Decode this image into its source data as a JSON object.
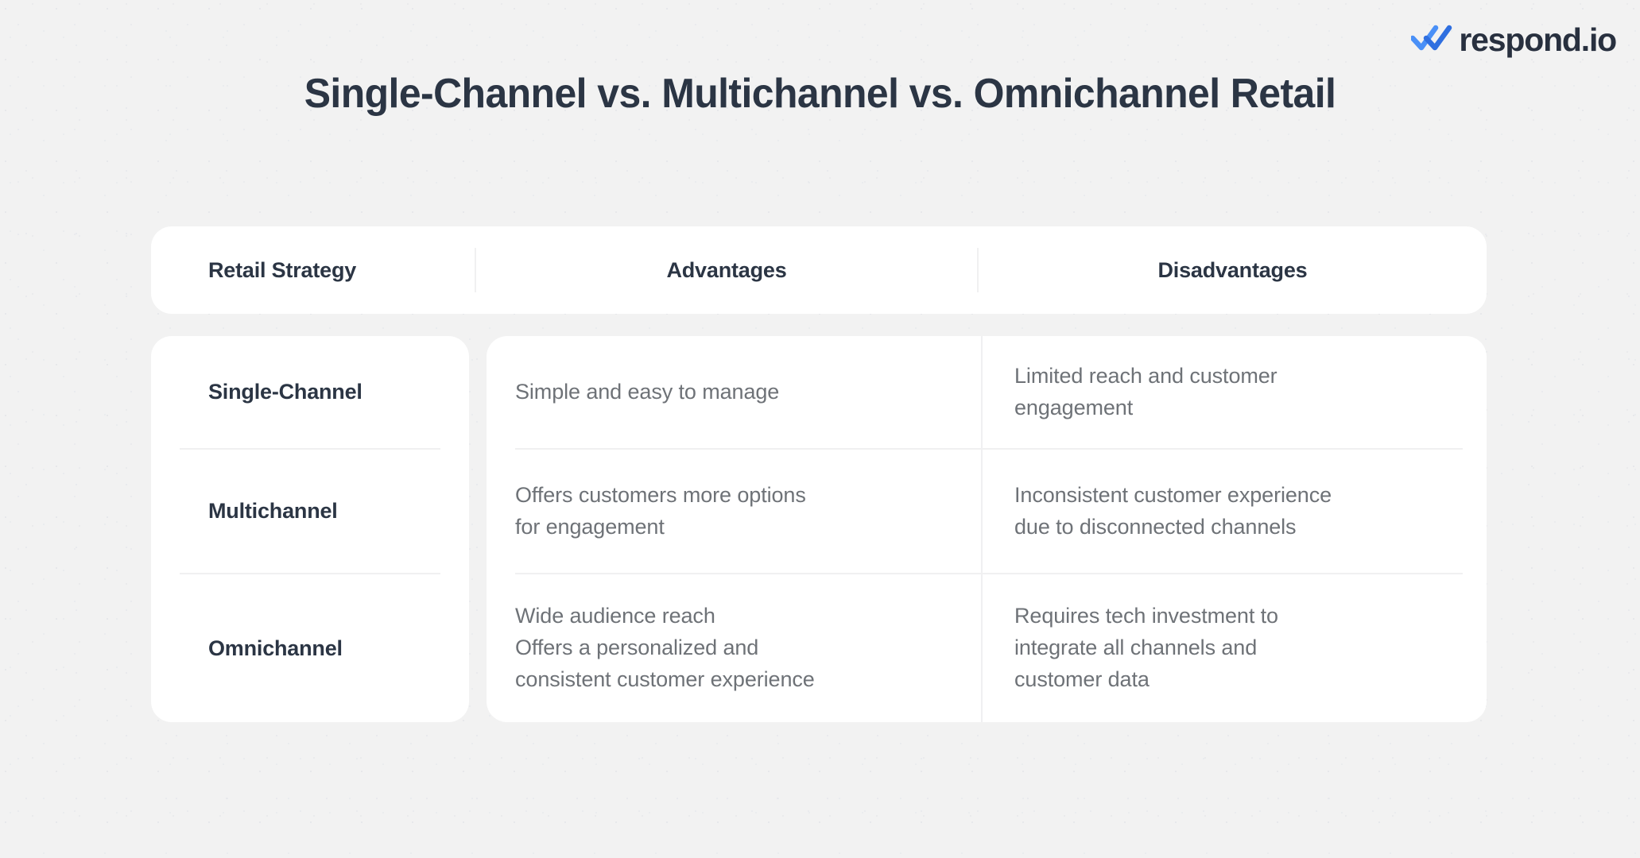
{
  "brand": {
    "logo_text": "respond.io",
    "logo_icon": "double-check-icon",
    "accent_color": "#4a90f7",
    "text_color": "#28303f"
  },
  "title": "Single-Channel vs. Multichannel vs. Omnichannel Retail",
  "colors": {
    "background": "#f2f2f2",
    "card": "#ffffff",
    "heading_text": "#2b3544",
    "body_text": "#6e7277",
    "divider": "#f0f0f1"
  },
  "table": {
    "columns": [
      {
        "label": "Retail Strategy"
      },
      {
        "label": "Advantages"
      },
      {
        "label": "Disadvantages"
      }
    ],
    "rows": [
      {
        "strategy": "Single-Channel",
        "advantages": "Simple and easy to manage",
        "disadvantages": "Limited reach and customer\nengagement"
      },
      {
        "strategy": "Multichannel",
        "advantages": "Offers customers more options\nfor engagement",
        "disadvantages": "Inconsistent customer experience\ndue to disconnected channels"
      },
      {
        "strategy": "Omnichannel",
        "advantages": "Wide audience reach\nOffers a personalized and\nconsistent customer experience",
        "disadvantages": "Requires tech investment to\nintegrate all channels and\ncustomer data"
      }
    ]
  }
}
